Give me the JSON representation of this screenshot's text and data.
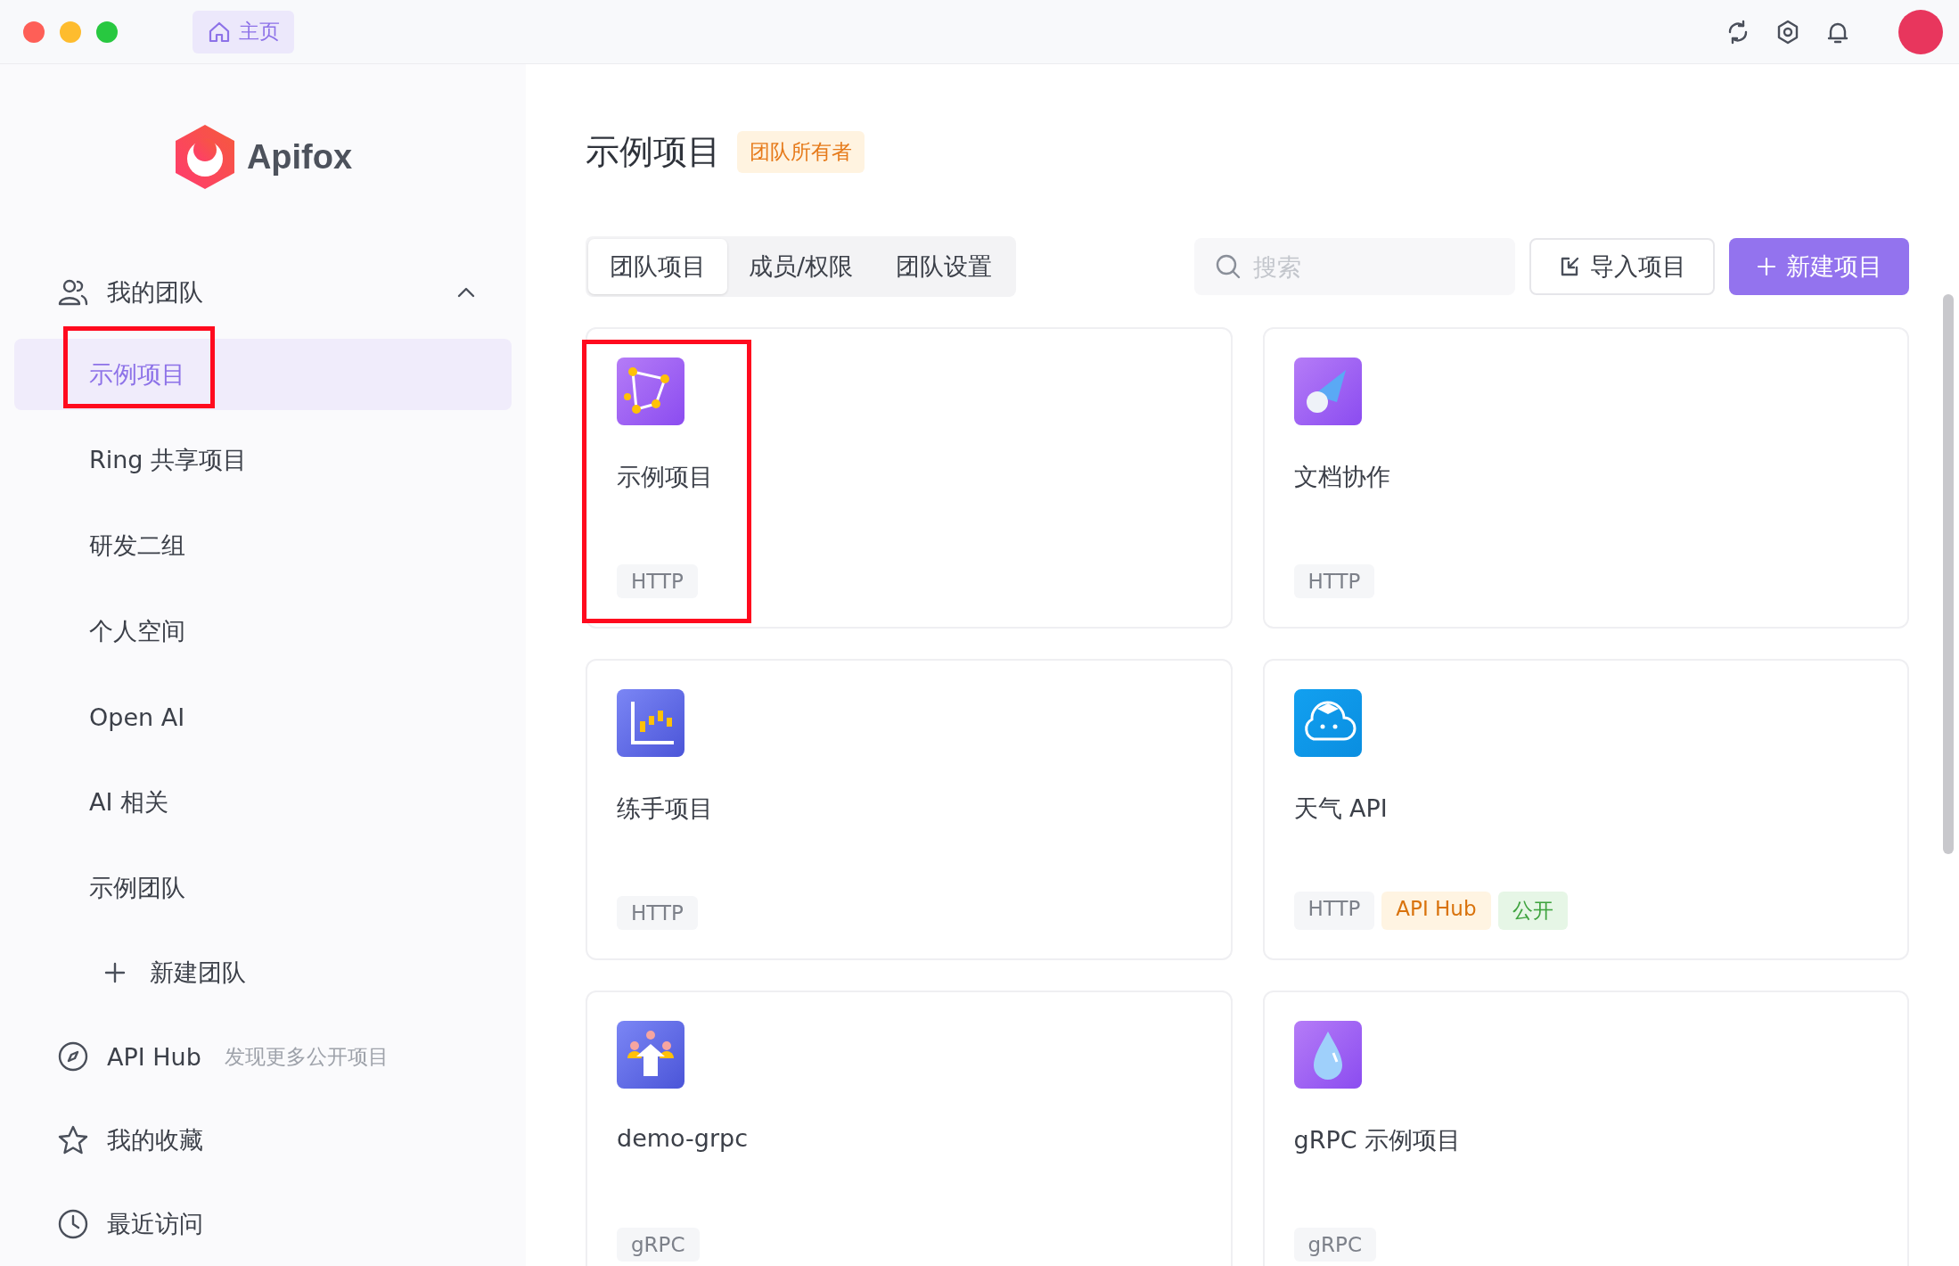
{
  "top_bar": {
    "home_tab": "主页"
  },
  "sidebar": {
    "brand": "Apifox",
    "team_group": {
      "label": "我的团队",
      "expanded": true,
      "teams": [
        {
          "label": "示例项目",
          "selected": true,
          "highlighted": true
        },
        {
          "label": "Ring 共享项目",
          "selected": false,
          "highlighted": false
        },
        {
          "label": "研发二组",
          "selected": false,
          "highlighted": false
        },
        {
          "label": "个人空间",
          "selected": false,
          "highlighted": false
        },
        {
          "label": "Open AI",
          "selected": false,
          "highlighted": false
        },
        {
          "label": "AI 相关",
          "selected": false,
          "highlighted": false
        },
        {
          "label": "示例团队",
          "selected": false,
          "highlighted": false
        }
      ],
      "add_label": "新建团队"
    },
    "links": [
      {
        "label": "API Hub",
        "hint": "发现更多公开项目"
      },
      {
        "label": "我的收藏"
      },
      {
        "label": "最近访问"
      }
    ]
  },
  "main": {
    "title": "示例项目",
    "role_badge": "团队所有者",
    "tabs": [
      {
        "label": "团队项目",
        "selected": true
      },
      {
        "label": "成员/权限",
        "selected": false
      },
      {
        "label": "团队设置",
        "selected": false
      }
    ],
    "search": {
      "placeholder": "搜索"
    },
    "buttons": {
      "import": "导入项目",
      "new": "新建项目"
    },
    "projects": [
      {
        "name": "示例项目",
        "highlighted": true,
        "tags": [
          {
            "label": "HTTP",
            "kind": "protocol"
          }
        ]
      },
      {
        "name": "文档协作",
        "highlighted": false,
        "tags": [
          {
            "label": "HTTP",
            "kind": "protocol"
          }
        ]
      },
      {
        "name": "练手项目",
        "highlighted": false,
        "tags": [
          {
            "label": "HTTP",
            "kind": "protocol"
          }
        ]
      },
      {
        "name": "天气 API",
        "highlighted": false,
        "tags": [
          {
            "label": "HTTP",
            "kind": "protocol"
          },
          {
            "label": "API Hub",
            "kind": "hub"
          },
          {
            "label": "公开",
            "kind": "public"
          }
        ]
      },
      {
        "name": "demo-grpc",
        "highlighted": false,
        "tags": [
          {
            "label": "gRPC",
            "kind": "protocol"
          }
        ]
      },
      {
        "name": "gRPC 示例项目",
        "highlighted": false,
        "tags": [
          {
            "label": "gRPC",
            "kind": "protocol"
          }
        ]
      }
    ]
  }
}
